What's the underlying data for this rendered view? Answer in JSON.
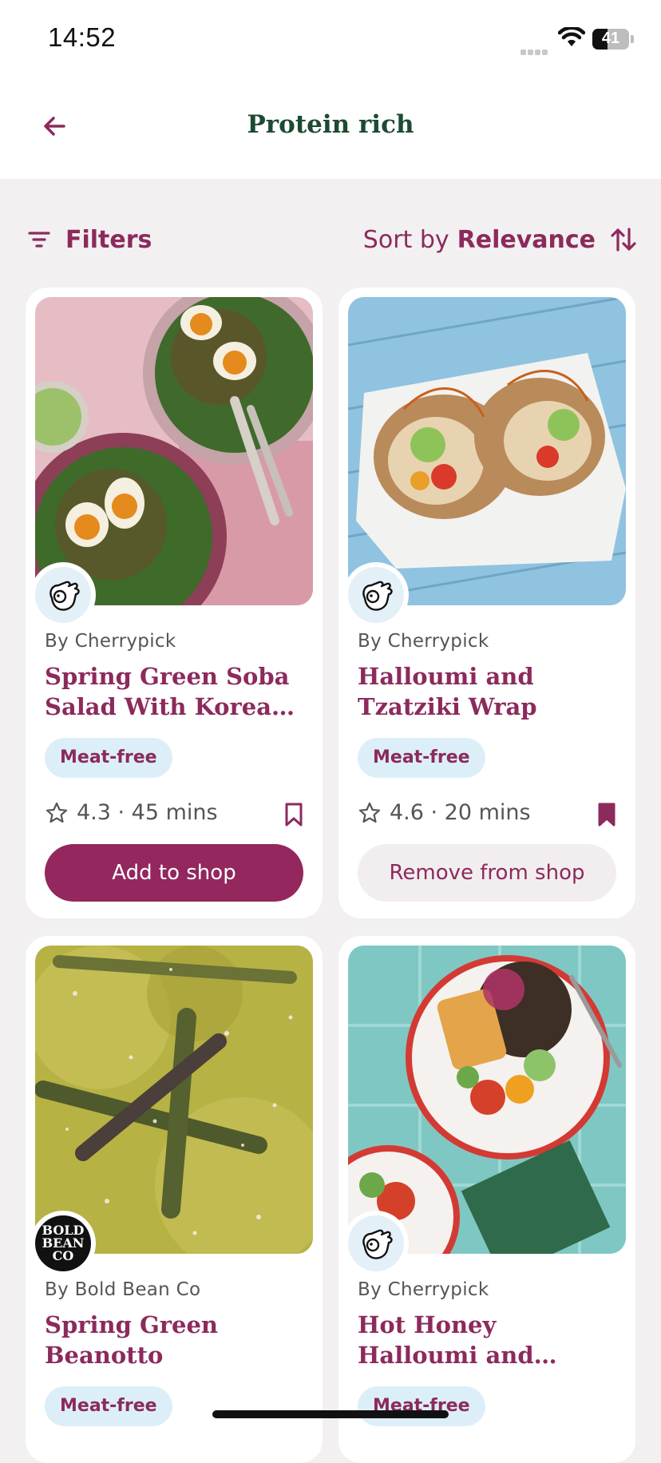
{
  "status_bar": {
    "time": "14:52",
    "battery": "41"
  },
  "header": {
    "title": "Protein rich",
    "back_icon": "arrow-left-icon"
  },
  "toolbar": {
    "filters_label": "Filters",
    "sort_prefix": "Sort by",
    "sort_value": "Relevance"
  },
  "colors": {
    "brand": "#8c2a5c",
    "primary_button": "#93275e",
    "title_green": "#1d4a32",
    "tag_bg": "#dceff9"
  },
  "recipes": [
    {
      "author": "By Cherrypick",
      "title": "Spring Green Soba Salad With Korean Eggs",
      "tag": "Meat-free",
      "meta": "4.3 · 45 mins",
      "saved": false,
      "shop_button": "Add to shop",
      "logo": "cherrypick-logo"
    },
    {
      "author": "By Cherrypick",
      "title": "Halloumi and Tzatziki Wrap",
      "tag": "Meat-free",
      "meta": "4.6 · 20 mins",
      "saved": true,
      "shop_button": "Remove from shop",
      "logo": "cherrypick-logo"
    },
    {
      "author": "By Bold Bean Co",
      "title": "Spring Green Beanotto",
      "tag": "Meat-free",
      "logo": "bold-bean-co-logo",
      "logo_text": "BOLD BEAN CO"
    },
    {
      "author": "By Cherrypick",
      "title": "Hot Honey Halloumi and Lentil Bowl",
      "tag": "Meat-free",
      "logo": "cherrypick-logo"
    }
  ]
}
